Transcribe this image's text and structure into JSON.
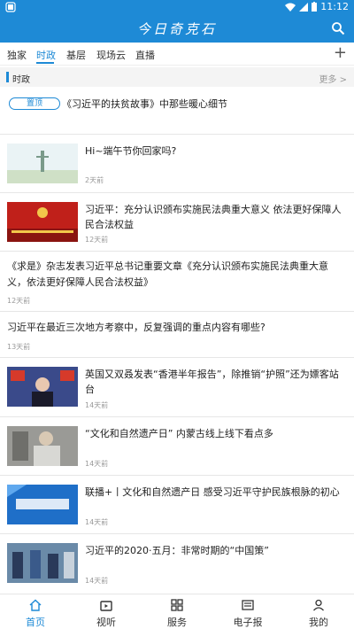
{
  "status": {
    "time": "11:12"
  },
  "app": {
    "title": "今日奇克石"
  },
  "tabs": [
    {
      "label": "独家"
    },
    {
      "label": "时政"
    },
    {
      "label": "基层"
    },
    {
      "label": "现场云"
    },
    {
      "label": "直播"
    }
  ],
  "section": {
    "title": "时政",
    "more": "更多 >"
  },
  "pinned": {
    "badge": "置顶",
    "title": "《习近平的扶贫故事》中那些暖心细节"
  },
  "news": [
    {
      "title": "Hi~端午节你回家吗?",
      "time": "2天前"
    },
    {
      "title": "习近平：充分认识颁布实施民法典重大意义 依法更好保障人民合法权益",
      "time": "12天前"
    },
    {
      "title": "《求是》杂志发表习近平总书记重要文章《充分认识颁布实施民法典重大意义，依法更好保障人民合法权益》",
      "time": "12天前"
    },
    {
      "title": "习近平在最近三次地方考察中，反复强调的重点内容有哪些?",
      "time": "13天前"
    },
    {
      "title": "英国又双叒发表“香港半年报告”，除推销“护照”还为嫖客站台",
      "time": "14天前"
    },
    {
      "title": "“文化和自然遗产日” 内蒙古线上线下看点多",
      "time": "14天前"
    },
    {
      "title": "联播+丨文化和自然遗产日 感受习近平守护民族根脉的初心",
      "time": "14天前"
    },
    {
      "title": "习近平的2020·五月：非常时期的“中国策”",
      "time": "14天前"
    }
  ],
  "nav": [
    {
      "label": "首页"
    },
    {
      "label": "视听"
    },
    {
      "label": "服务"
    },
    {
      "label": "电子报"
    },
    {
      "label": "我的"
    }
  ],
  "colors": {
    "brand": "#1e8ad6"
  }
}
